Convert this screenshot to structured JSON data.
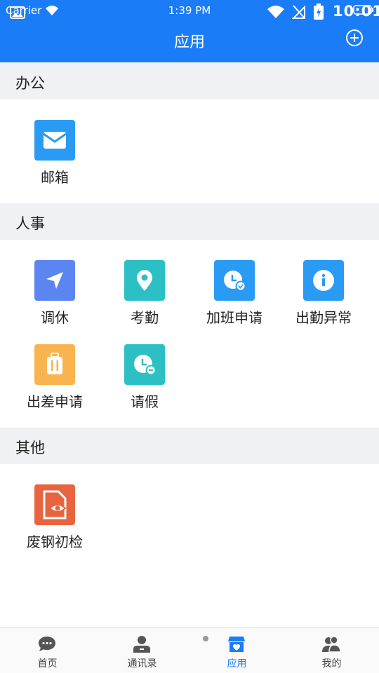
{
  "status_bar": {
    "carrier": "Carrier",
    "time": "1:39 PM",
    "time_right": "10:01"
  },
  "header": {
    "title": "应用"
  },
  "sections": [
    {
      "title": "办公",
      "apps": [
        {
          "label": "邮箱",
          "icon": "mail-icon",
          "color": "#2a9bf5"
        }
      ]
    },
    {
      "title": "人事",
      "apps": [
        {
          "label": "调休",
          "icon": "navigation-arrow-icon",
          "color": "#5b86f2"
        },
        {
          "label": "考勤",
          "icon": "location-pin-icon",
          "color": "#2cc0c4"
        },
        {
          "label": "加班申请",
          "icon": "clock-check-icon",
          "color": "#2a9bf5"
        },
        {
          "label": "出勤异常",
          "icon": "info-icon",
          "color": "#2a9bf5"
        },
        {
          "label": "出差申请",
          "icon": "suitcase-icon",
          "color": "#f9b450"
        },
        {
          "label": "请假",
          "icon": "clock-minus-icon",
          "color": "#2cc0c4"
        }
      ]
    },
    {
      "title": "其他",
      "apps": [
        {
          "label": "废钢初检",
          "icon": "document-eye-icon",
          "color": "#e8643f"
        }
      ]
    }
  ],
  "tabbar": {
    "tabs": [
      {
        "label": "首页",
        "icon": "chat-bubble-icon",
        "active": false
      },
      {
        "label": "通讯录",
        "icon": "contact-person-icon",
        "active": false
      },
      {
        "label": "应用",
        "icon": "store-icon",
        "active": true
      },
      {
        "label": "我的",
        "icon": "users-icon",
        "active": false
      }
    ]
  }
}
